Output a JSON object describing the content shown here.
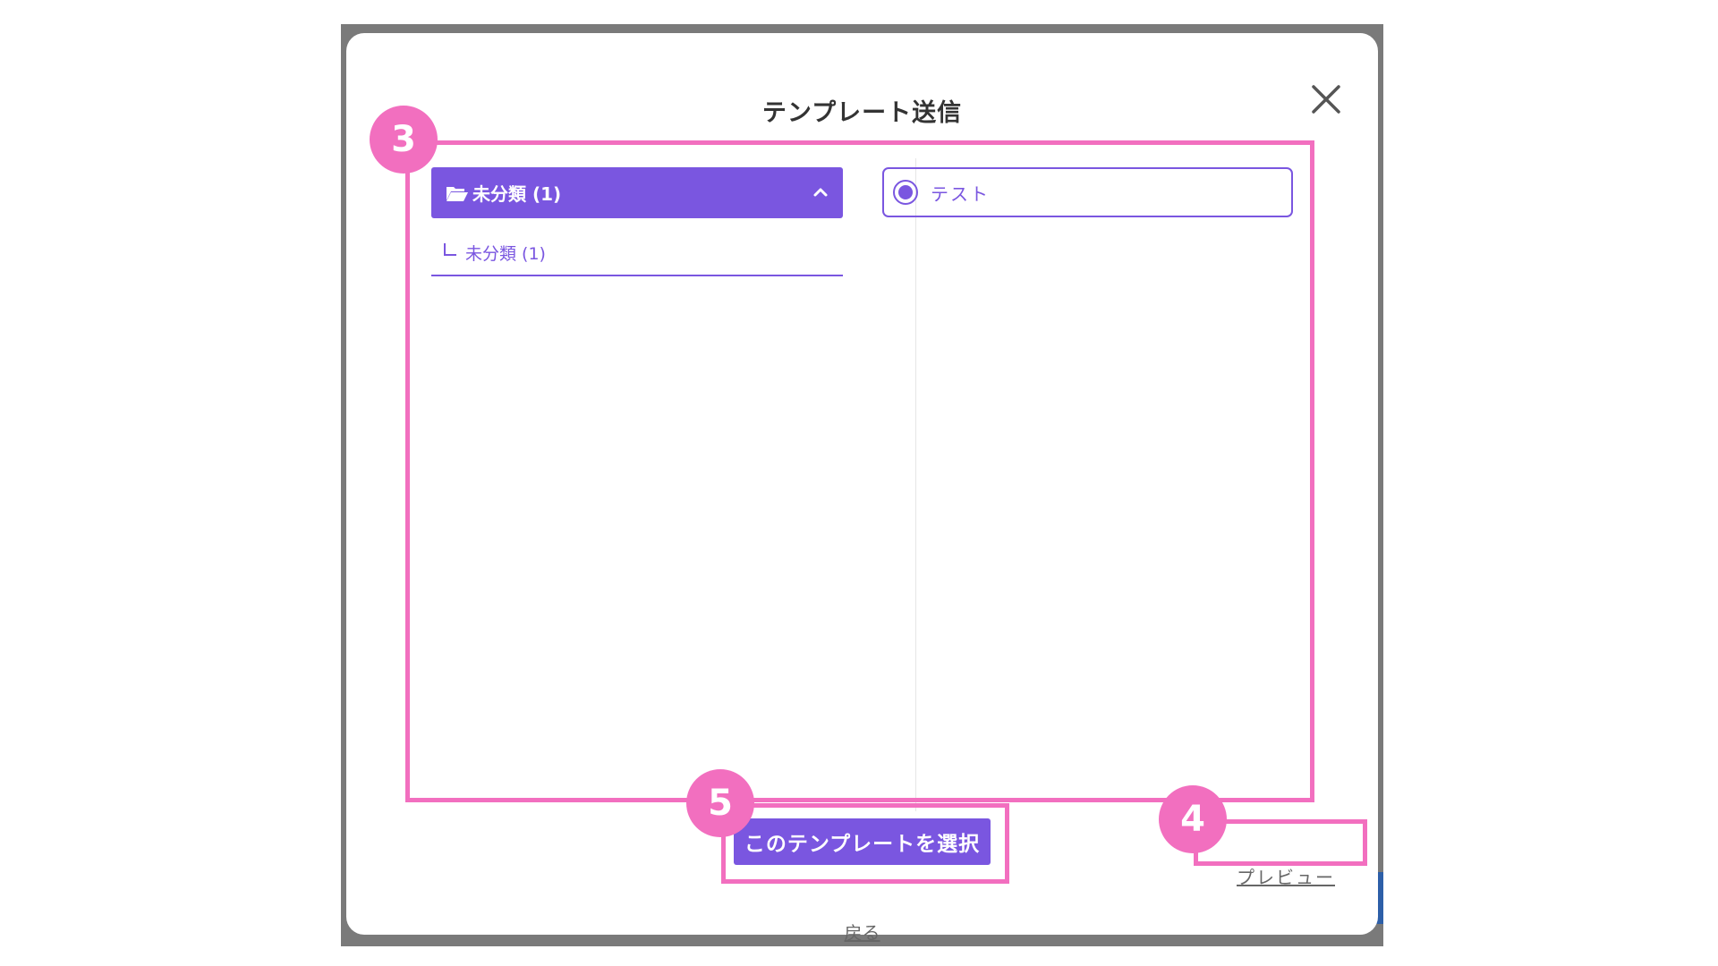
{
  "modal": {
    "title": "テンプレート送信",
    "close_icon": "close-icon"
  },
  "folders": {
    "header_icon": "folder-open-icon",
    "header_label": "未分類 (1)",
    "header_chevron": "chevron-up-icon",
    "subfolder_label": "未分類 (1)"
  },
  "templates": [
    {
      "label": "テスト",
      "selected": true
    }
  ],
  "actions": {
    "select_label": "このテンプレートを選択",
    "preview_label": "プレビュー",
    "back_label": "戻る"
  },
  "annotations": {
    "markers": [
      "3",
      "4",
      "5"
    ],
    "color": "#f26fbf"
  },
  "colors": {
    "accent": "#7a56e0",
    "backdrop": "#7a7a7a",
    "annotation": "#f26fbf"
  }
}
